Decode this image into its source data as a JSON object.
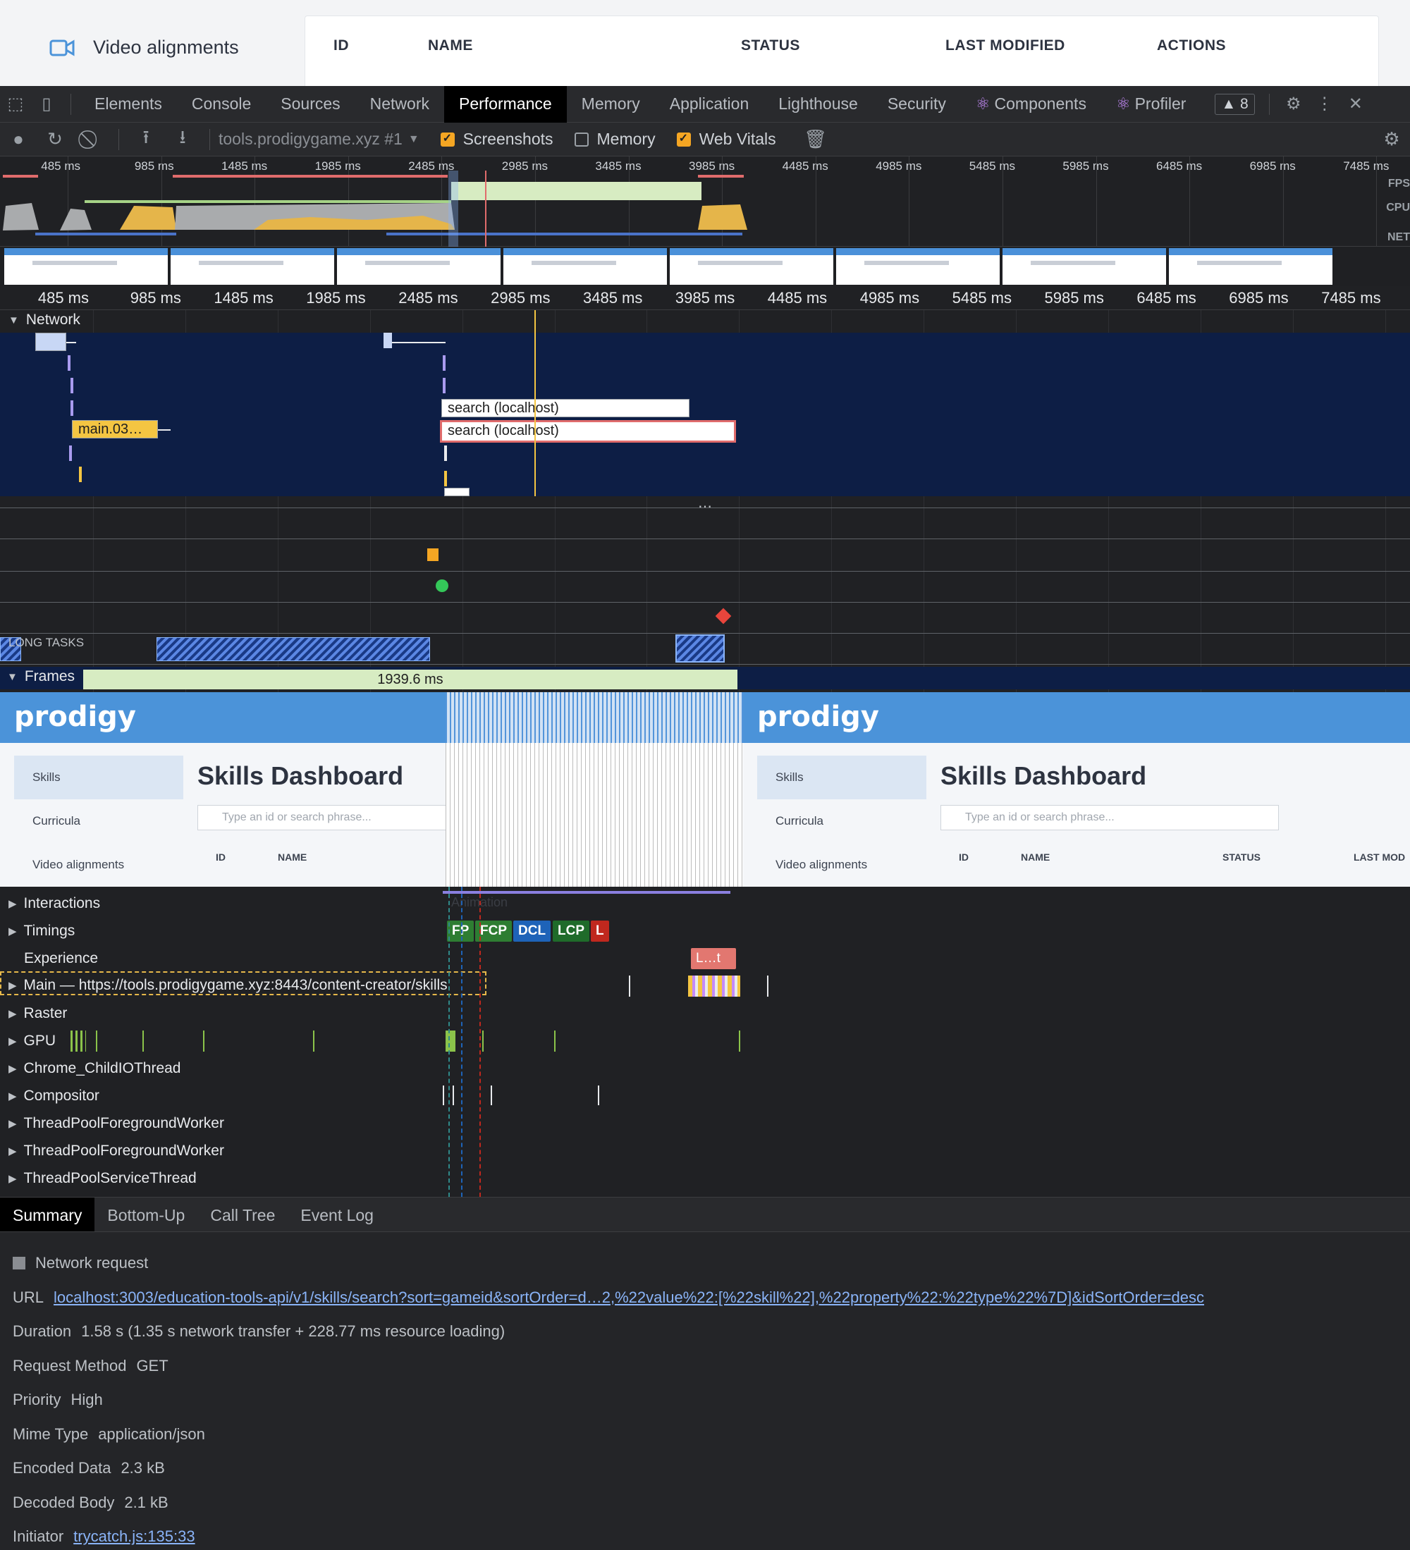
{
  "page": {
    "nav_item": "Video alignments",
    "table_headers": [
      "ID",
      "NAME",
      "STATUS",
      "LAST MODIFIED",
      "ACTIONS"
    ]
  },
  "devtools": {
    "tabs": [
      "Elements",
      "Console",
      "Sources",
      "Network",
      "Performance",
      "Memory",
      "Application",
      "Lighthouse",
      "Security"
    ],
    "active_tab": "Performance",
    "react_tabs": [
      "Components",
      "Profiler"
    ],
    "warning_count": "▲ 8",
    "recording_target": "tools.prodigygame.xyz #1",
    "options": [
      {
        "label": "Screenshots",
        "checked": true
      },
      {
        "label": "Memory",
        "checked": false
      },
      {
        "label": "Web Vitals",
        "checked": true
      }
    ]
  },
  "overview": {
    "ticks": [
      "485 ms",
      "985 ms",
      "1485 ms",
      "1985 ms",
      "2485 ms",
      "2985 ms",
      "3485 ms",
      "3985 ms",
      "4485 ms",
      "4985 ms",
      "5485 ms",
      "5985 ms",
      "6485 ms",
      "6985 ms",
      "7485 ms"
    ],
    "labels": [
      "FPS",
      "CPU",
      "NET"
    ]
  },
  "ruler_ticks": [
    "485 ms",
    "985 ms",
    "1485 ms",
    "1985 ms",
    "2485 ms",
    "2985 ms",
    "3485 ms",
    "3985 ms",
    "4485 ms",
    "4985 ms",
    "5485 ms",
    "5985 ms",
    "6485 ms",
    "6985 ms",
    "7485 ms"
  ],
  "network": {
    "label": "Network",
    "requests": [
      "main.03…",
      "search (localhost)",
      "search (localhost)"
    ]
  },
  "long_tasks_label": "LONG TASKS",
  "frames": {
    "label": "Frames",
    "duration": "1939.6 ms",
    "animation_label": "Animation",
    "screenshot": {
      "logo": "prodigy",
      "title": "Skills Dashboard",
      "sidebar": [
        "Skills",
        "Curricula",
        "Video alignments"
      ],
      "search_placeholder": "Type an id or search phrase...",
      "columns": [
        "ID",
        "NAME",
        "STATUS",
        "LAST MOD"
      ]
    }
  },
  "tracks": {
    "interactions": "Interactions",
    "timings": "Timings",
    "timing_pills": [
      "FP",
      "FCP",
      "DCL",
      "LCP",
      "L"
    ],
    "experience": "Experience",
    "experience_pill": "L…t",
    "main": "Main — https://tools.prodigygame.xyz:8443/content-creator/skills",
    "raster": "Raster",
    "gpu": "GPU",
    "child_io": "Chrome_ChildIOThread",
    "compositor": "Compositor",
    "pool1": "ThreadPoolForegroundWorker",
    "pool2": "ThreadPoolForegroundWorker",
    "pool_service": "ThreadPoolServiceThread"
  },
  "bottom_tabs": [
    "Summary",
    "Bottom-Up",
    "Call Tree",
    "Event Log"
  ],
  "summary": {
    "title": "Network request",
    "url_label": "URL",
    "url": "localhost:3003/education-tools-api/v1/skills/search?sort=gameid&sortOrder=d…2,%22value%22:[%22skill%22],%22property%22:%22type%22%7D]&idSortOrder=desc",
    "duration_label": "Duration",
    "duration": "1.58 s (1.35 s network transfer + 228.77 ms resource loading)",
    "method_label": "Request Method",
    "method": "GET",
    "priority_label": "Priority",
    "priority": "High",
    "mime_label": "Mime Type",
    "mime": "application/json",
    "encoded_label": "Encoded Data",
    "encoded": "2.3 kB",
    "decoded_label": "Decoded Body",
    "decoded": "2.1 kB",
    "initiator_label": "Initiator",
    "initiator": "trycatch.js:135:33"
  }
}
